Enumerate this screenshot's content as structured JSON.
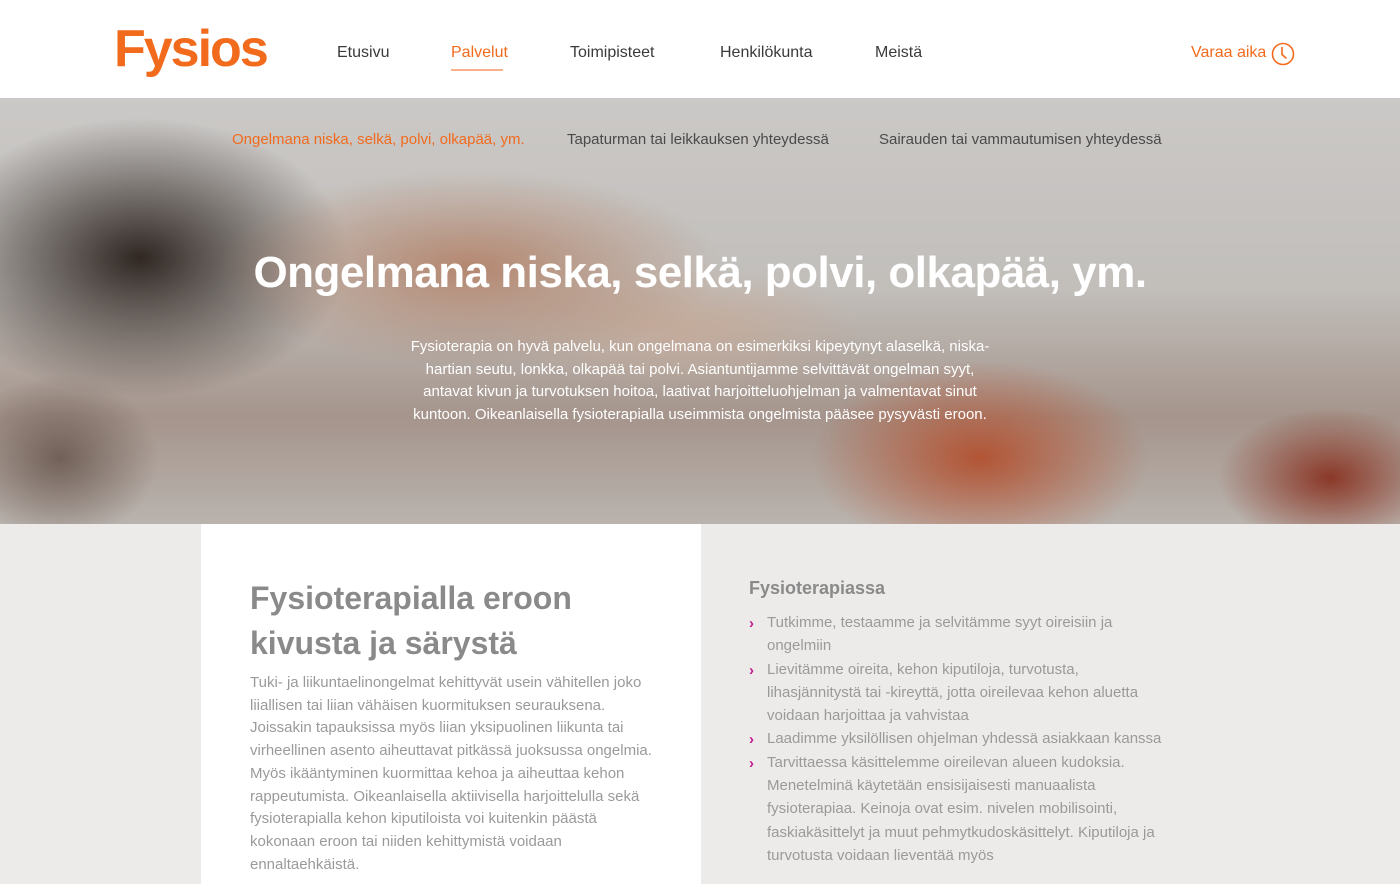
{
  "header": {
    "logo": "Fysios",
    "nav": [
      {
        "label": "Etusivu",
        "active": false
      },
      {
        "label": "Palvelut",
        "active": true
      },
      {
        "label": "Toimipisteet",
        "active": false
      },
      {
        "label": "Henkilökunta",
        "active": false
      },
      {
        "label": "Meistä",
        "active": false
      }
    ],
    "book_label": "Varaa aika",
    "book_icon": "clock-icon"
  },
  "hero": {
    "subnav": [
      {
        "label": "Ongelmana niska, selkä, polvi, olkapää, ym.",
        "active": true
      },
      {
        "label": "Tapaturman tai leikkauksen yhteydessä",
        "active": false
      },
      {
        "label": "Sairauden tai vammautumisen yhteydessä",
        "active": false
      }
    ],
    "title": "Ongelmana niska, selkä, polvi, olkapää, ym.",
    "text": "Fysioterapia on hyvä palvelu, kun ongelmana on esimerkiksi kipeytynyt alaselkä, niska-hartian seutu, lonkka, olkapää tai polvi. Asiantuntijamme selvittävät ongelman syyt, antavat kivun ja turvotuksen hoitoa, laativat harjoitteluohjelman ja valmentavat sinut kuntoon. Oikeanlaisella fysioterapialla useimmista ongelmista pääsee pysyvästi eroon."
  },
  "left": {
    "heading": "Fysioterapialla eroon kivusta ja särystä",
    "text": "Tuki- ja liikuntaelinongelmat kehittyvät usein vähitellen joko liiallisen tai liian vähäisen kuormituksen seurauksena. Joissakin tapauksissa myös liian yksipuolinen liikunta tai virheellinen asento aiheuttavat pitkässä juoksussa ongelmia. Myös ikääntyminen kuormittaa kehoa ja aiheuttaa kehon rappeutumista. Oikeanlaisella aktiivisella harjoittelulla sekä fysioterapialla kehon kiputiloista voi kuitenkin päästä kokonaan eroon tai niiden kehittymistä voidaan ennaltaehkäistä."
  },
  "right": {
    "heading": "Fysioterapiassa",
    "bullet_icon": "chevron-right-icon",
    "bullet_color": "#c2188f",
    "items": [
      "Tutkimme, testaamme ja selvitämme syyt oireisiin ja ongelmiin",
      "Lievitämme oireita, kehon kiputiloja, turvotusta, lihasjännitystä tai -kireyttä, jotta oireilevaa kehon aluetta voidaan harjoittaa ja vahvistaa",
      "Laadimme yksilöllisen ohjelman yhdessä asiakkaan kanssa",
      "Tarvittaessa käsittelemme oireilevan alueen kudoksia. Menetelminä käytetään ensisijaisesti manuaalista fysioterapiaa. Keinoja ovat esim. nivelen mobilisointi, faskiakäsittelyt ja muut pehmytkudoskäsittelyt. Kiputiloja ja turvotusta voidaan lieventää myös"
    ]
  },
  "colors": {
    "brand": "#f26b1d",
    "bullet": "#c2188f"
  }
}
